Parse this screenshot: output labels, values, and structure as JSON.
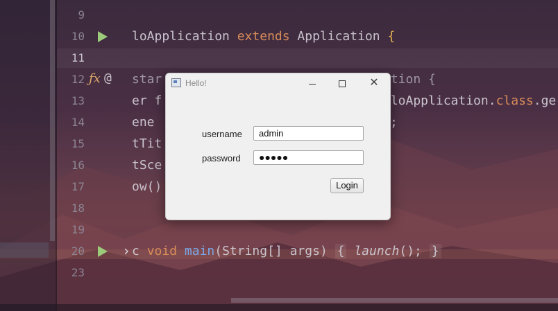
{
  "editor": {
    "line_numbers": [
      "9",
      "10",
      "11",
      "12",
      "13",
      "14",
      "15",
      "16",
      "17",
      "18",
      "19",
      "20",
      "23"
    ],
    "active_line": "11",
    "code": {
      "l10_a": "loApplication ",
      "l10_kw": "extends",
      "l10_b": " Application ",
      "l10_brace": "{",
      "l12_a": "star",
      "l12_b": "ation {",
      "l13_a": "er f",
      "l13_b": "lloApplication.",
      "l13_kw": "class",
      "l13_c": ".ge",
      "l14_a": "ene",
      "l14_b": ";",
      "l15_a": "tTit",
      "l16_a": "tSce",
      "l17_a": "ow()",
      "l20_a": "c ",
      "l20_kw": "void",
      "l20_fn": "main",
      "l20_b": "(String[] args) ",
      "l20_open": "{",
      "l20_call": "launch",
      "l20_c": "();",
      "l20_close": "}"
    },
    "colors": {
      "keyword": "#d88c5a",
      "function": "#7aa7e8",
      "text": "#c9c3cc",
      "brace": "#e3b44f",
      "run": "#9ccc7a"
    }
  },
  "dialog": {
    "title": "Hello!",
    "username_label": "username",
    "username_value": "admin",
    "password_label": "password",
    "password_value": "●●●●●",
    "login_label": "Login"
  }
}
